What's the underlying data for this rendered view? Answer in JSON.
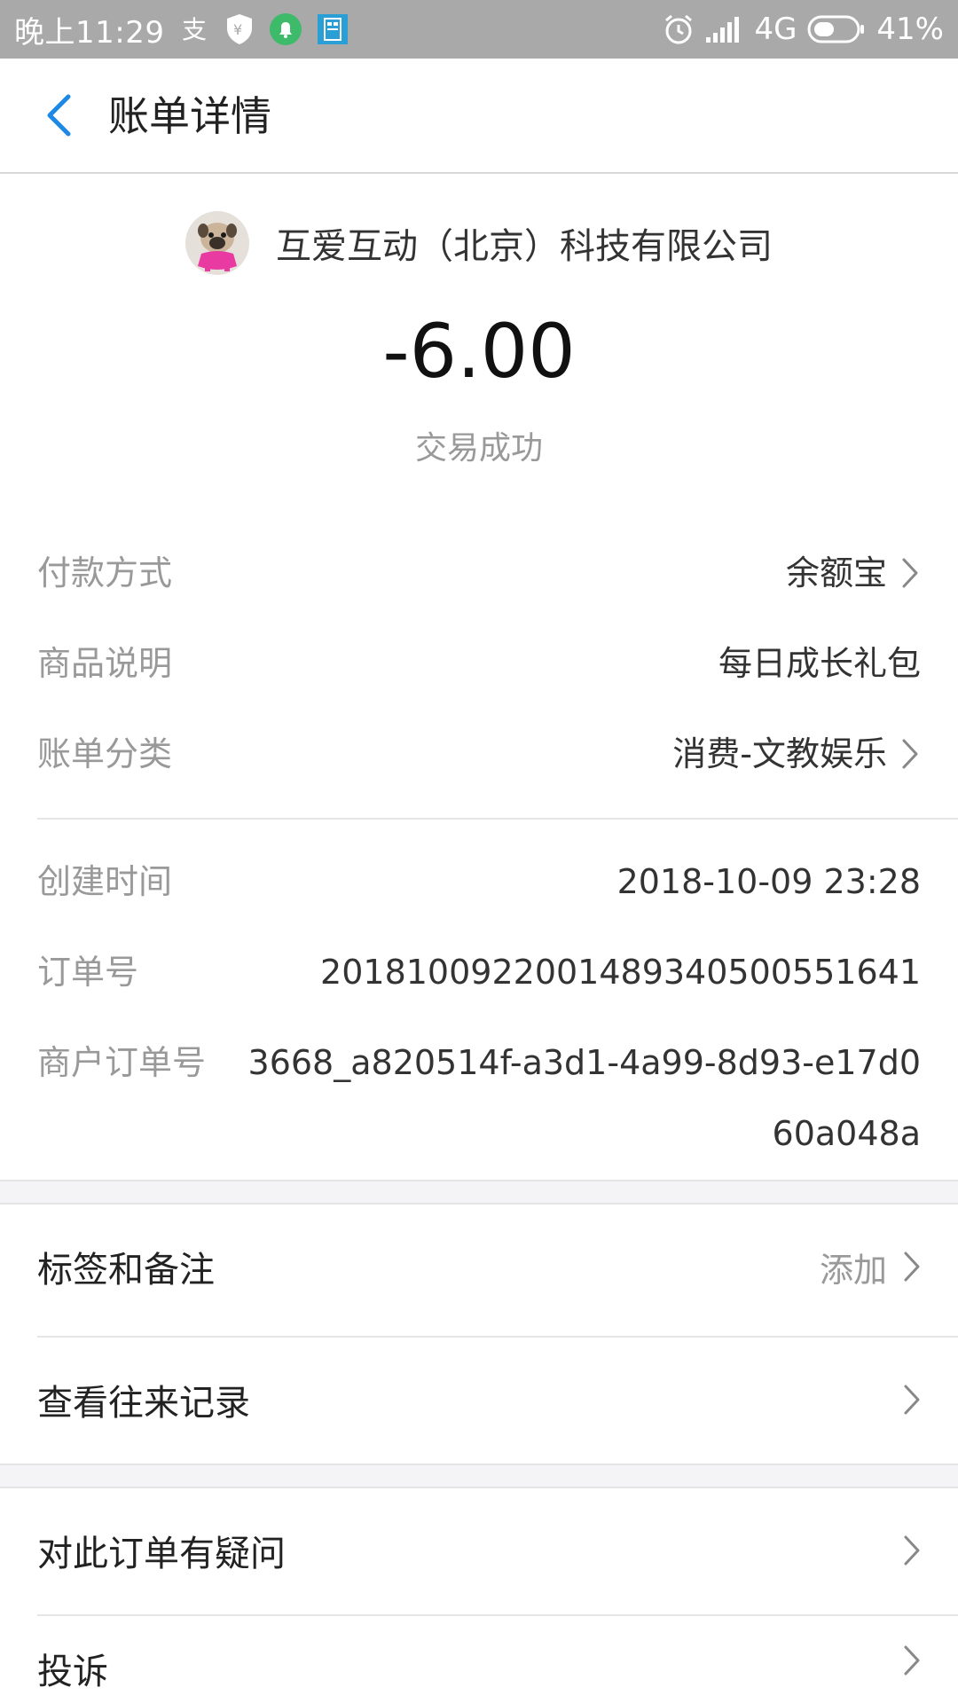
{
  "status_bar": {
    "time": "晚上11:29",
    "network": "4G",
    "battery": "41%",
    "left_icons": [
      "alipay-icon",
      "shield-yen-icon",
      "notification-bell-icon",
      "sim-card-icon"
    ],
    "right_icons": [
      "alarm-icon",
      "signal-icon",
      "battery-icon"
    ]
  },
  "header": {
    "title": "账单详情"
  },
  "merchant": {
    "name": "互爱互动（北京）科技有限公司"
  },
  "amount": "-6.00",
  "trade_status": "交易成功",
  "details": {
    "payment_method": {
      "label": "付款方式",
      "value": "余额宝"
    },
    "product_desc": {
      "label": "商品说明",
      "value": "每日成长礼包"
    },
    "category": {
      "label": "账单分类",
      "value": "消费-文教娱乐"
    },
    "created_time": {
      "label": "创建时间",
      "value": "2018-10-09 23:28"
    },
    "order_no": {
      "label": "订单号",
      "value": "20181009220014893405005516​41"
    },
    "merchant_order_no": {
      "label": "商户订单号",
      "value": "3668_a820514f-a3d1-4a99-8d93-e17d060a048a"
    }
  },
  "menu": {
    "tags_notes": {
      "label": "标签和备注",
      "hint": "添加"
    },
    "history": {
      "label": "查看往来记录"
    },
    "question": {
      "label": "对此订单有疑问"
    },
    "complaint": {
      "label": "投诉"
    }
  },
  "colors": {
    "status_bar_bg": "#a9a9a9",
    "accent_blue": "#1e88e5",
    "label_gray": "#999999",
    "section_bg": "#f4f4f6"
  }
}
